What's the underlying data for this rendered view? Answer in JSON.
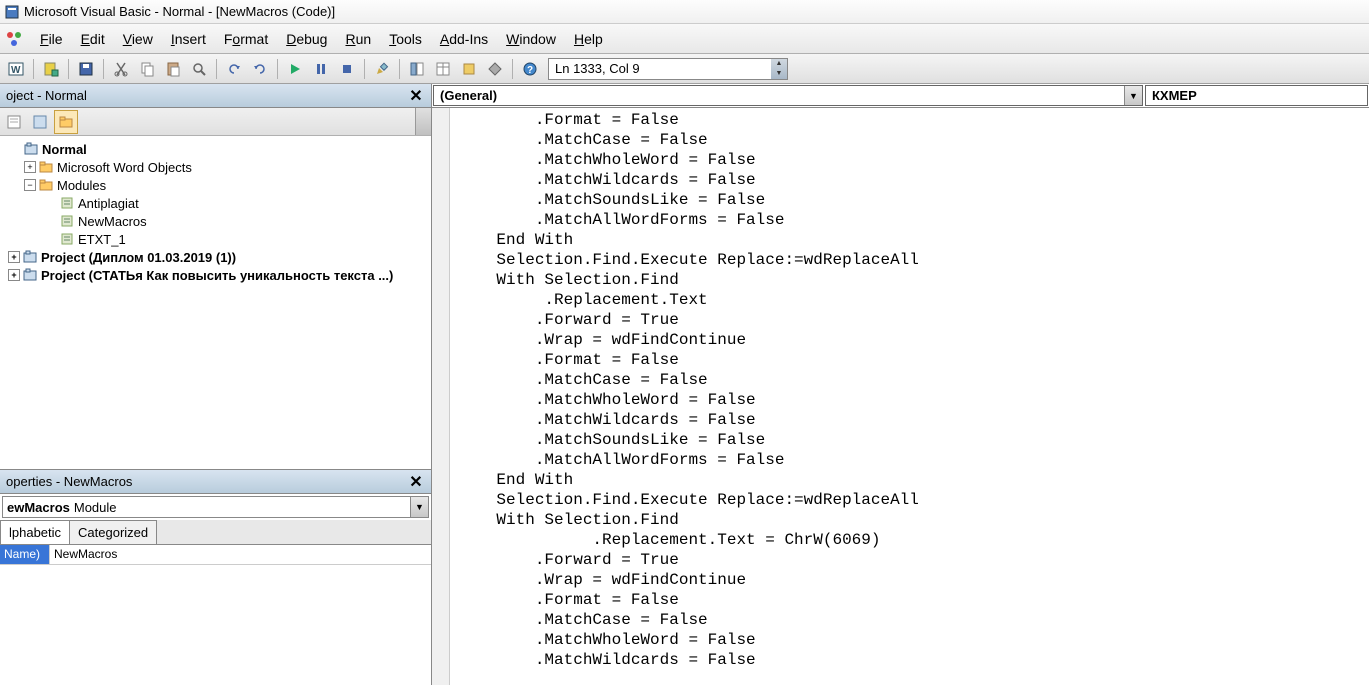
{
  "titlebar": {
    "text": "Microsoft Visual Basic - Normal - [NewMacros (Code)]"
  },
  "menu": {
    "items": [
      "File",
      "Edit",
      "View",
      "Insert",
      "Format",
      "Debug",
      "Run",
      "Tools",
      "Add-Ins",
      "Window",
      "Help"
    ]
  },
  "toolbar": {
    "status": "Ln 1333, Col 9"
  },
  "project_panel": {
    "title": "oject - Normal",
    "tree": {
      "normal": "Normal",
      "word_objects": "Microsoft Word Objects",
      "modules": "Modules",
      "module_items": [
        "Antiplagiat",
        "NewMacros",
        "ETXT_1"
      ],
      "project1": "Project (Диплом 01.03.2019 (1))",
      "project2": "Project (СТАТЬя Как повысить уникальность текста ...)"
    }
  },
  "properties_panel": {
    "title": "operties - NewMacros",
    "object_name": "ewMacros",
    "object_type": "Module",
    "tab_alphabetic": "lphabetic",
    "tab_categorized": "Categorized",
    "prop_name_label": "Name)",
    "prop_name_value": "NewMacros"
  },
  "code_panel": {
    "dropdown_general": "(General)",
    "dropdown_proc": "КХМЕР"
  },
  "code_lines": [
    "        .Format = False",
    "        .MatchCase = False",
    "        .MatchWholeWord = False",
    "        .MatchWildcards = False",
    "        .MatchSoundsLike = False",
    "        .MatchAllWordForms = False",
    "    End With",
    "    Selection.Find.Execute Replace:=wdReplaceAll",
    "    With Selection.Find",
    "         .Replacement.Text",
    "        .Forward = True",
    "        .Wrap = wdFindContinue",
    "        .Format = False",
    "        .MatchCase = False",
    "        .MatchWholeWord = False",
    "        .MatchWildcards = False",
    "        .MatchSoundsLike = False",
    "        .MatchAllWordForms = False",
    "    End With",
    "    Selection.Find.Execute Replace:=wdReplaceAll",
    "    With Selection.Find",
    "              .Replacement.Text = ChrW(6069)",
    "        .Forward = True",
    "        .Wrap = wdFindContinue",
    "        .Format = False",
    "        .MatchCase = False",
    "        .MatchWholeWord = False",
    "        .MatchWildcards = False"
  ]
}
